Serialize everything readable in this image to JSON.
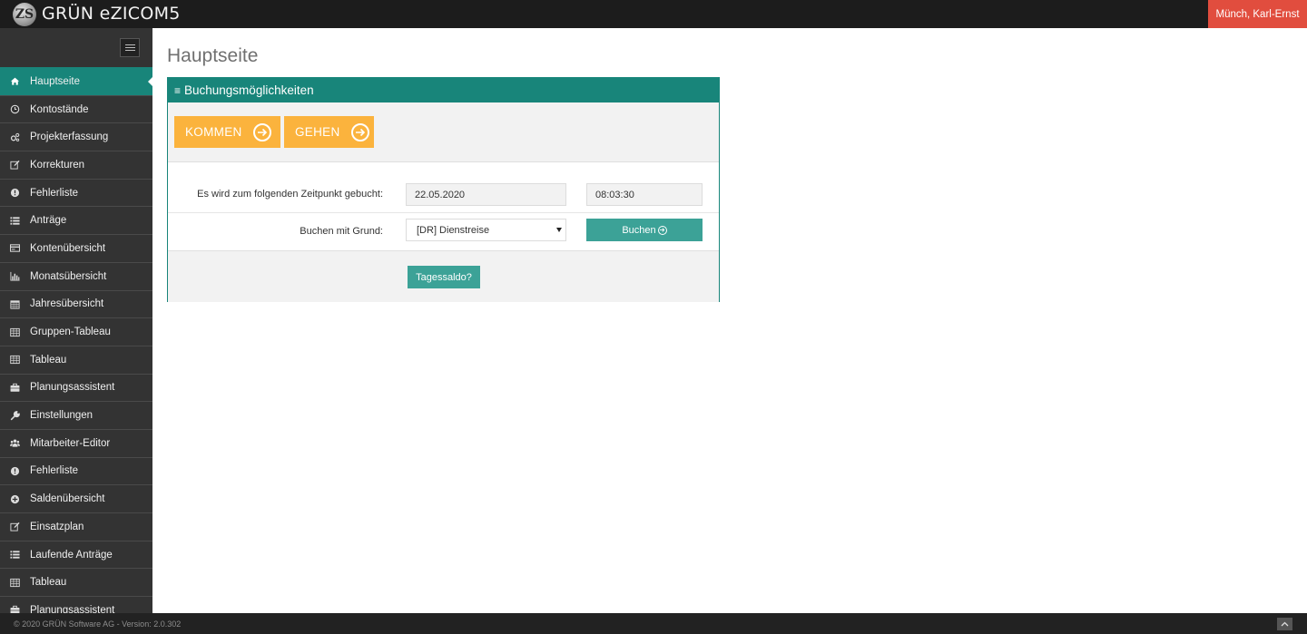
{
  "app": {
    "logo_mark": "ZS",
    "title": "GRÜN eZICOM5",
    "user": "Münch, Karl-Ernst"
  },
  "sidebar": {
    "items": [
      {
        "label": "Hauptseite",
        "icon": "home-icon",
        "active": true
      },
      {
        "label": "Kontostände",
        "icon": "clock-icon"
      },
      {
        "label": "Projekterfassung",
        "icon": "cogs-icon"
      },
      {
        "label": "Korrekturen",
        "icon": "edit-icon"
      },
      {
        "label": "Fehlerliste",
        "icon": "exclamation-icon"
      },
      {
        "label": "Anträge",
        "icon": "list-icon"
      },
      {
        "label": "Kontenübersicht",
        "icon": "card-icon"
      },
      {
        "label": "Monatsübersicht",
        "icon": "bar-chart-icon"
      },
      {
        "label": "Jahresübersicht",
        "icon": "calendar-icon"
      },
      {
        "label": "Gruppen-Tableau",
        "icon": "table-icon"
      },
      {
        "label": "Tableau",
        "icon": "table-icon"
      },
      {
        "label": "Planungsassistent",
        "icon": "briefcase-icon"
      },
      {
        "label": "Einstellungen",
        "icon": "wrench-icon"
      },
      {
        "label": "Mitarbeiter-Editor",
        "icon": "users-icon"
      },
      {
        "label": "Fehlerliste",
        "icon": "exclamation-icon"
      },
      {
        "label": "Saldenübersicht",
        "icon": "plus-circle-icon"
      },
      {
        "label": "Einsatzplan",
        "icon": "edit-icon"
      },
      {
        "label": "Laufende Anträge",
        "icon": "list-icon"
      },
      {
        "label": "Tableau",
        "icon": "table-icon"
      },
      {
        "label": "Planungsassistent",
        "icon": "briefcase-icon"
      }
    ]
  },
  "main": {
    "page_title": "Hauptseite",
    "panel": {
      "heading": "Buchungsmöglichkeiten",
      "kommen_label": "KOMMEN",
      "gehen_label": "GEHEN",
      "time_label": "Es wird zum folgenden Zeitpunkt gebucht:",
      "date_value": "22.05.2020",
      "time_value": "08:03:30",
      "reason_label": "Buchen mit Grund:",
      "reason_selected": "[DR] Dienstreise",
      "buchen_label": "Buchen",
      "tagessaldo_label": "Tagessaldo?"
    }
  },
  "footer": {
    "text": "© 2020 GRÜN Software AG - Version: 2.0.302"
  },
  "colors": {
    "accent": "#18857a",
    "button_teal": "#3ca297",
    "orange": "#fbb33d",
    "user_red": "#e14d3e",
    "sidebar": "#333333",
    "topbar": "#1c1c1c"
  }
}
